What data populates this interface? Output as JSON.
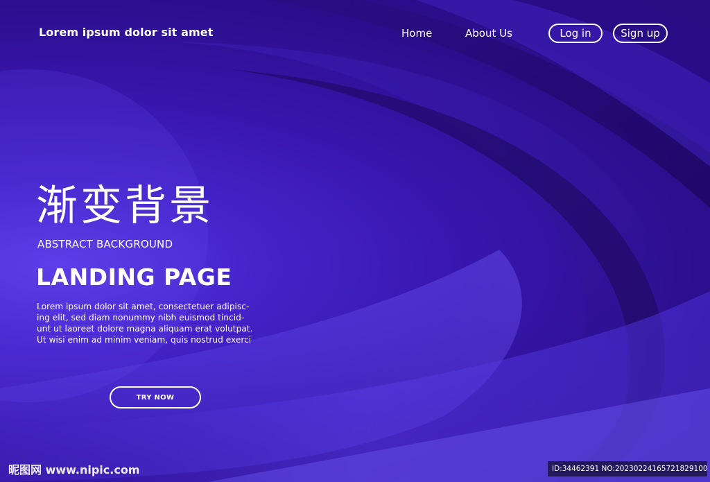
{
  "header": {
    "brand": "Lorem ipsum dolor sit amet",
    "nav": {
      "home": "Home",
      "about": "About Us",
      "login": "Log in",
      "signup": "Sign up"
    }
  },
  "hero": {
    "chinese_title": "渐变背景",
    "subtitle": "ABSTRACT BACKGROUND",
    "title": "LANDING PAGE",
    "body_lines": [
      "Lorem ipsum dolor sit amet, consectetuer adipisc-",
      "ing elit, sed diam nonummy nibh euismod tincid-",
      "unt ut laoreet dolore magna aliquam erat volutpat.",
      "Ut wisi enim ad minim veniam, quis nostrud exerci"
    ],
    "cta": "TRY NOW"
  },
  "watermark": {
    "site": "昵图网 www.nipic.com",
    "id_text": "ID:34462391 NO:20230224165721829100"
  },
  "colors": {
    "background_dark": "#230a72",
    "background_mid": "#3716ad",
    "background_light": "#5a3be6",
    "text": "#ffffff"
  }
}
